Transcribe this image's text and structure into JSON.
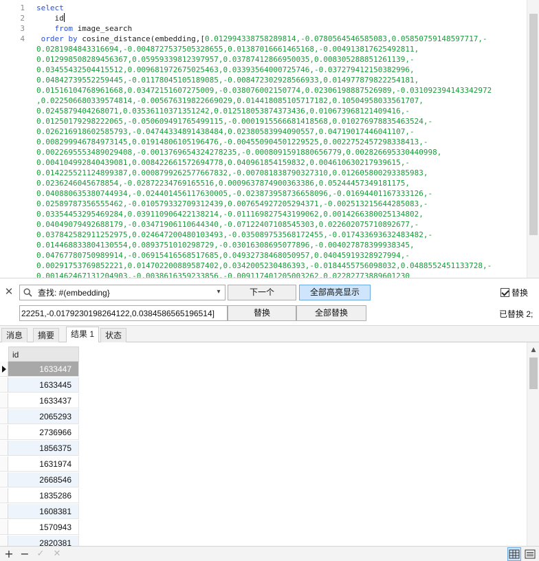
{
  "editor": {
    "line_numbers": [
      "1",
      "2",
      "3",
      "4"
    ],
    "lines": [
      [
        {
          "t": "select",
          "c": "kw"
        }
      ],
      [
        {
          "t": "    id",
          "c": "pl"
        },
        {
          "caret": true
        }
      ],
      [
        {
          "t": "    ",
          "c": "pl"
        },
        {
          "t": "from",
          "c": "kw"
        },
        {
          "t": " image_search",
          "c": "pl"
        }
      ],
      [
        {
          "t": " ",
          "c": "pl"
        },
        {
          "t": "order by",
          "c": "kw"
        },
        {
          "t": " cosine_distance(embedding,[",
          "c": "pl"
        },
        {
          "t": "0.012994338758289814,-0.0780564546585083,0.05850759148597717,-",
          "c": "num"
        }
      ],
      [
        {
          "t": "0.0281984843316694,-0.0048727537505328655,0.01387016661465168,-0.004913817625492811,",
          "c": "num"
        }
      ],
      [
        {
          "t": "0.012998508289456367,0.05959339812397957,0.03787412866950035,0.008305288851261139,-",
          "c": "num"
        }
      ],
      [
        {
          "t": "0.03455432504415512,0.009681972675025463,0.03393564000725746,-0.037279412150382996,",
          "c": "num"
        }
      ],
      [
        {
          "t": "0.04842739552259445,-0.01178045105189085,-0.008472302928566933,0.014977879822254181,",
          "c": "num"
        }
      ],
      [
        {
          "t": "0.01516104768961668,0.03472151607275009,-0.038076002150774,0.02306198887526989,-0.031092394143342972",
          "c": "num"
        }
      ],
      [
        {
          "t": ",0.022506680339574814,-0.005676319822669029,0.014418085105717182,0.10504958033561707,",
          "c": "num"
        }
      ],
      [
        {
          "t": "0.0245879404268071,0.03536110371351242,0.012518053874373436,0.010673968121409416,-",
          "c": "num"
        }
      ],
      [
        {
          "t": "0.01250179298222065,-0.050609491765499115,-0.0001915566681418568,0.010276978835463524,-",
          "c": "num"
        }
      ],
      [
        {
          "t": "0.026216918602585793,-0.04744334891438484,0.02380583994090557,0.04719017446041107,-",
          "c": "num"
        }
      ],
      [
        {
          "t": "0.008299946784973145,0.01914806105196476,-0.004550904501229525,0.0022752457298338413,-",
          "c": "num"
        }
      ],
      [
        {
          "t": "0.0022695553489029408,-0.0013769654324278235,-0.0008091591880656779,0.002826695330440998,",
          "c": "num"
        }
      ],
      [
        {
          "t": "0.004104992840439081,0.008422661572694778,0.040961854159832,0.004610630217939615,-",
          "c": "num"
        }
      ],
      [
        {
          "t": "0.014225521124899387,0.0008799262577667832,-0.007081838790327310,0.012605800293385983,",
          "c": "num"
        }
      ],
      [
        {
          "t": "0.0236246045678854,-0.02872234769165516,0.0009637874900363386,0.05244457349181175,",
          "c": "num"
        }
      ],
      [
        {
          "t": "0.040880635380744934,-0.024401456117630005,-0.023873958736658096,-0.01694401167333126,-",
          "c": "num"
        }
      ],
      [
        {
          "t": "0.02589787356555462,-0.010579332709312439,0.007654927205294371,-0.002513215644285083,-",
          "c": "num"
        }
      ],
      [
        {
          "t": "0.03354453295469284,0.039110906422138214,-0.011169827543199062,0.0014266380025134802,",
          "c": "num"
        }
      ],
      [
        {
          "t": "0.04049079492688179,-0.03471906110644340,-0.07122407108545303,0.022602075710892677,-",
          "c": "num"
        }
      ],
      [
        {
          "t": "0.037842582911252975,0.024647200480103493,-0.035089753568172455,-0.017433693632483482,-",
          "c": "num"
        }
      ],
      [
        {
          "t": "0.014468833804130554,0.0893751010298729,-0.03016308695077896,-0.004027878399938345,",
          "c": "num"
        }
      ],
      [
        {
          "t": "0.04767780750989914,-0.06915416568517685,0.04932738468050957,0.04045919328927994,-",
          "c": "num"
        }
      ],
      [
        {
          "t": "0.00291753769852221,0.014702200889587402,0.0342005230486393,-0.0184455756098032,0.0488552451133728,-",
          "c": "num"
        }
      ],
      [
        {
          "t": "0.001462467131204903,-0.0038616359233856,-0.009117401205003262,0.02282773889601230",
          "c": "num"
        }
      ]
    ]
  },
  "find": {
    "close_label": "✕",
    "search_value": "查找: #(embedding}",
    "next_label": "下一个",
    "highlight_all_label": "全部高亮显示",
    "replace_checkbox_label": "替换",
    "replace_value": "22251,-0.0179230198264122,0.0384586565196514]",
    "replace_label": "替换",
    "replace_all_label": "全部替换",
    "status": "已替换 2;"
  },
  "tabs": [
    {
      "label": "消息",
      "active": false
    },
    {
      "label": "摘要",
      "active": false
    },
    {
      "label": "结果 1",
      "active": true
    },
    {
      "label": "状态",
      "active": false
    }
  ],
  "grid": {
    "columns": [
      "id"
    ],
    "rows": [
      "1633447",
      "1633445",
      "1633437",
      "2065293",
      "2736966",
      "1856375",
      "1631974",
      "2668546",
      "1835286",
      "1608381",
      "1570943",
      "2820381"
    ],
    "selected_row": 0
  },
  "toolbar": {
    "add": "+",
    "remove": "−",
    "apply": "✓",
    "discard": "✕"
  }
}
